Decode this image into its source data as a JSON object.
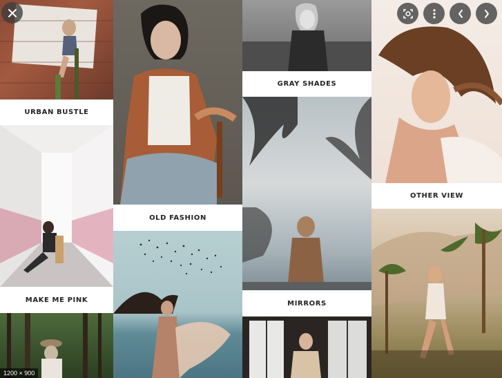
{
  "captions": {
    "urban_bustle": "URBAN BUSTLE",
    "make_me_pink": "MAKE ME PINK",
    "old_fashion": "OLD FASHION",
    "gray_shades": "GRAY SHADES",
    "mirrors": "MIRRORS",
    "other_view": "OTHER VIEW"
  },
  "image_info": {
    "dimensions": "1200 × 900"
  },
  "controls": {
    "close": "close-icon",
    "lens": "lens-search-icon",
    "more": "more-vertical-icon",
    "prev": "chevron-left-icon",
    "next": "chevron-right-icon"
  },
  "colors": {
    "caption_text": "#222222",
    "control_bg": "#3c3c3c",
    "control_icon": "#ffffff"
  }
}
